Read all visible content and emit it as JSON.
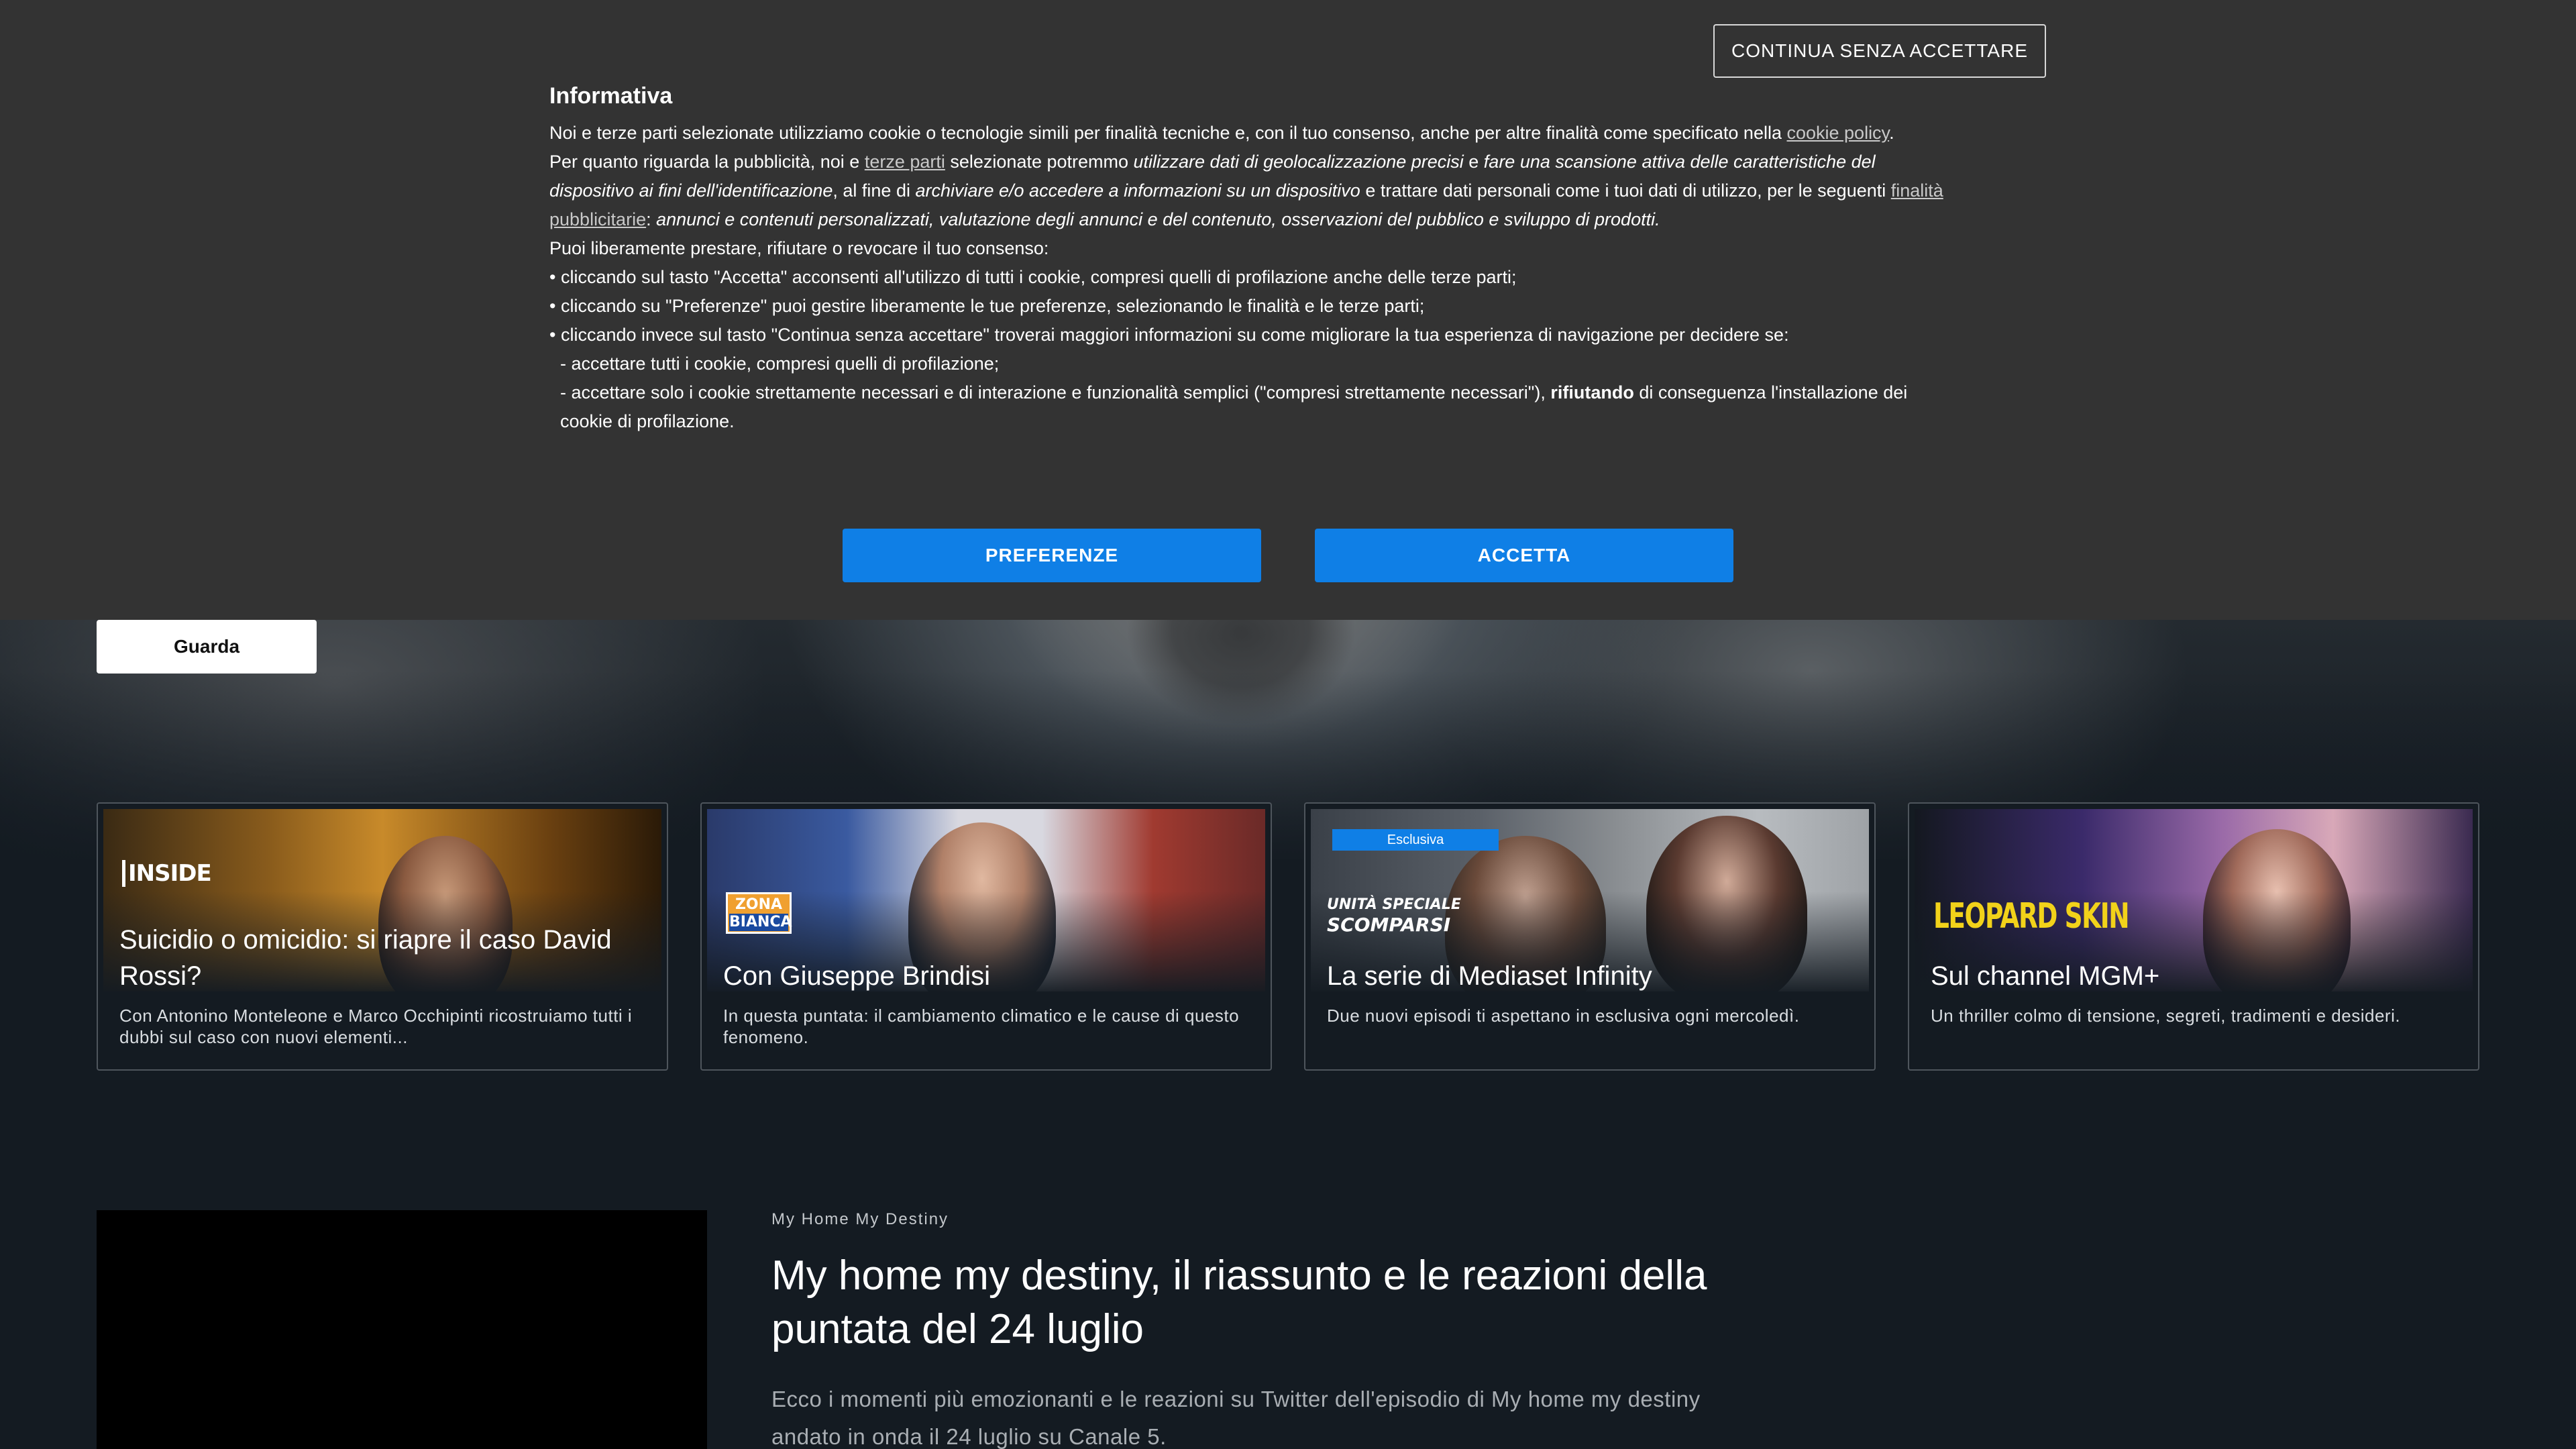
{
  "cookie_banner": {
    "continue_label": "CONTINUA SENZA ACCETTARE",
    "heading": "Informativa",
    "p1_a": "Noi e terze parti selezionate utilizziamo cookie o tecnologie simili per finalità tecniche e, con il tuo consenso, anche per altre finalità come specificato nella ",
    "p1_link": "cookie policy",
    "p1_b": ".",
    "p2_a": "Per quanto riguarda la pubblicità, noi e ",
    "p2_link1": "terze parti",
    "p2_b": " selezionate potremmo ",
    "p2_i1": "utilizzare dati di geolocalizzazione precisi",
    "p2_c": " e ",
    "p2_i2": "fare una scansione attiva delle caratteristiche del dispositivo ai fini dell'identificazione",
    "p2_d": ", al fine di ",
    "p2_i3": "archiviare e/o accedere a informazioni su un dispositivo",
    "p2_e": " e trattare dati personali come i tuoi dati di utilizzo, per le seguenti ",
    "p2_link2": "finalità pubblicitarie",
    "p2_f": ": ",
    "p2_i4": "annunci e contenuti personalizzati, valutazione degli annunci e del contenuto, osservazioni del pubblico e sviluppo di prodotti.",
    "p3": "Puoi liberamente prestare, rifiutare o revocare il tuo consenso:",
    "b1": "• cliccando sul tasto \"Accetta\" acconsenti all'utilizzo di tutti i cookie, compresi quelli di profilazione anche delle terze parti;",
    "b2": "• cliccando su \"Preferenze\" puoi gestire liberamente le tue preferenze, selezionando le finalità e le terze parti;",
    "b3": "• cliccando invece sul tasto \"Continua senza accettare\" troverai maggiori informazioni su come migliorare la tua esperienza di navigazione per decidere se:",
    "s1": "- accettare tutti i cookie, compresi quelli di profilazione;",
    "s2_a": "- accettare solo i cookie strettamente necessari e di interazione e funzionalità semplici (\"compresi strettamente necessari\"), ",
    "s2_bold": "rifiutando",
    "s2_b": " di conseguenza l'installazione dei cookie di profilazione.",
    "preferences_label": "PREFERENZE",
    "accept_label": "ACCETTA"
  },
  "hero": {
    "watch_label": "Guarda"
  },
  "cards": [
    {
      "logo": "INSIDE",
      "badge": "",
      "title": "Suicidio o omicidio: si riapre il caso David Rossi?",
      "description": "Con Antonino Monteleone e Marco Occhipinti ricostruiamo tutti i dubbi sul caso con nuovi elementi..."
    },
    {
      "logo_top": "ZONA",
      "logo_bottom": "BIANCA",
      "badge": "",
      "title": "Con Giuseppe Brindisi",
      "description": "In questa puntata: il cambiamento climatico e le cause di questo fenomeno."
    },
    {
      "logo_top": "UNITÀ SPECIALE",
      "logo_bottom": "SCOMPARSI",
      "badge": "Esclusiva",
      "title": "La serie di Mediaset Infinity",
      "description": "Due nuovi episodi ti aspettano in esclusiva ogni mercoledì."
    },
    {
      "logo": "LEOPARD SKIN",
      "badge": "",
      "title": "Sul channel MGM+",
      "description": "Un thriller colmo di tensione, segreti, tradimenti e desideri."
    }
  ],
  "article": {
    "kicker": "My Home My Destiny",
    "title": "My home my destiny, il riassunto e le reazioni della puntata del 24 luglio",
    "description": "Ecco i momenti più emozionanti e le reazioni su Twitter dell'episodio di My home my destiny andato in onda il 24 luglio su Canale 5."
  }
}
